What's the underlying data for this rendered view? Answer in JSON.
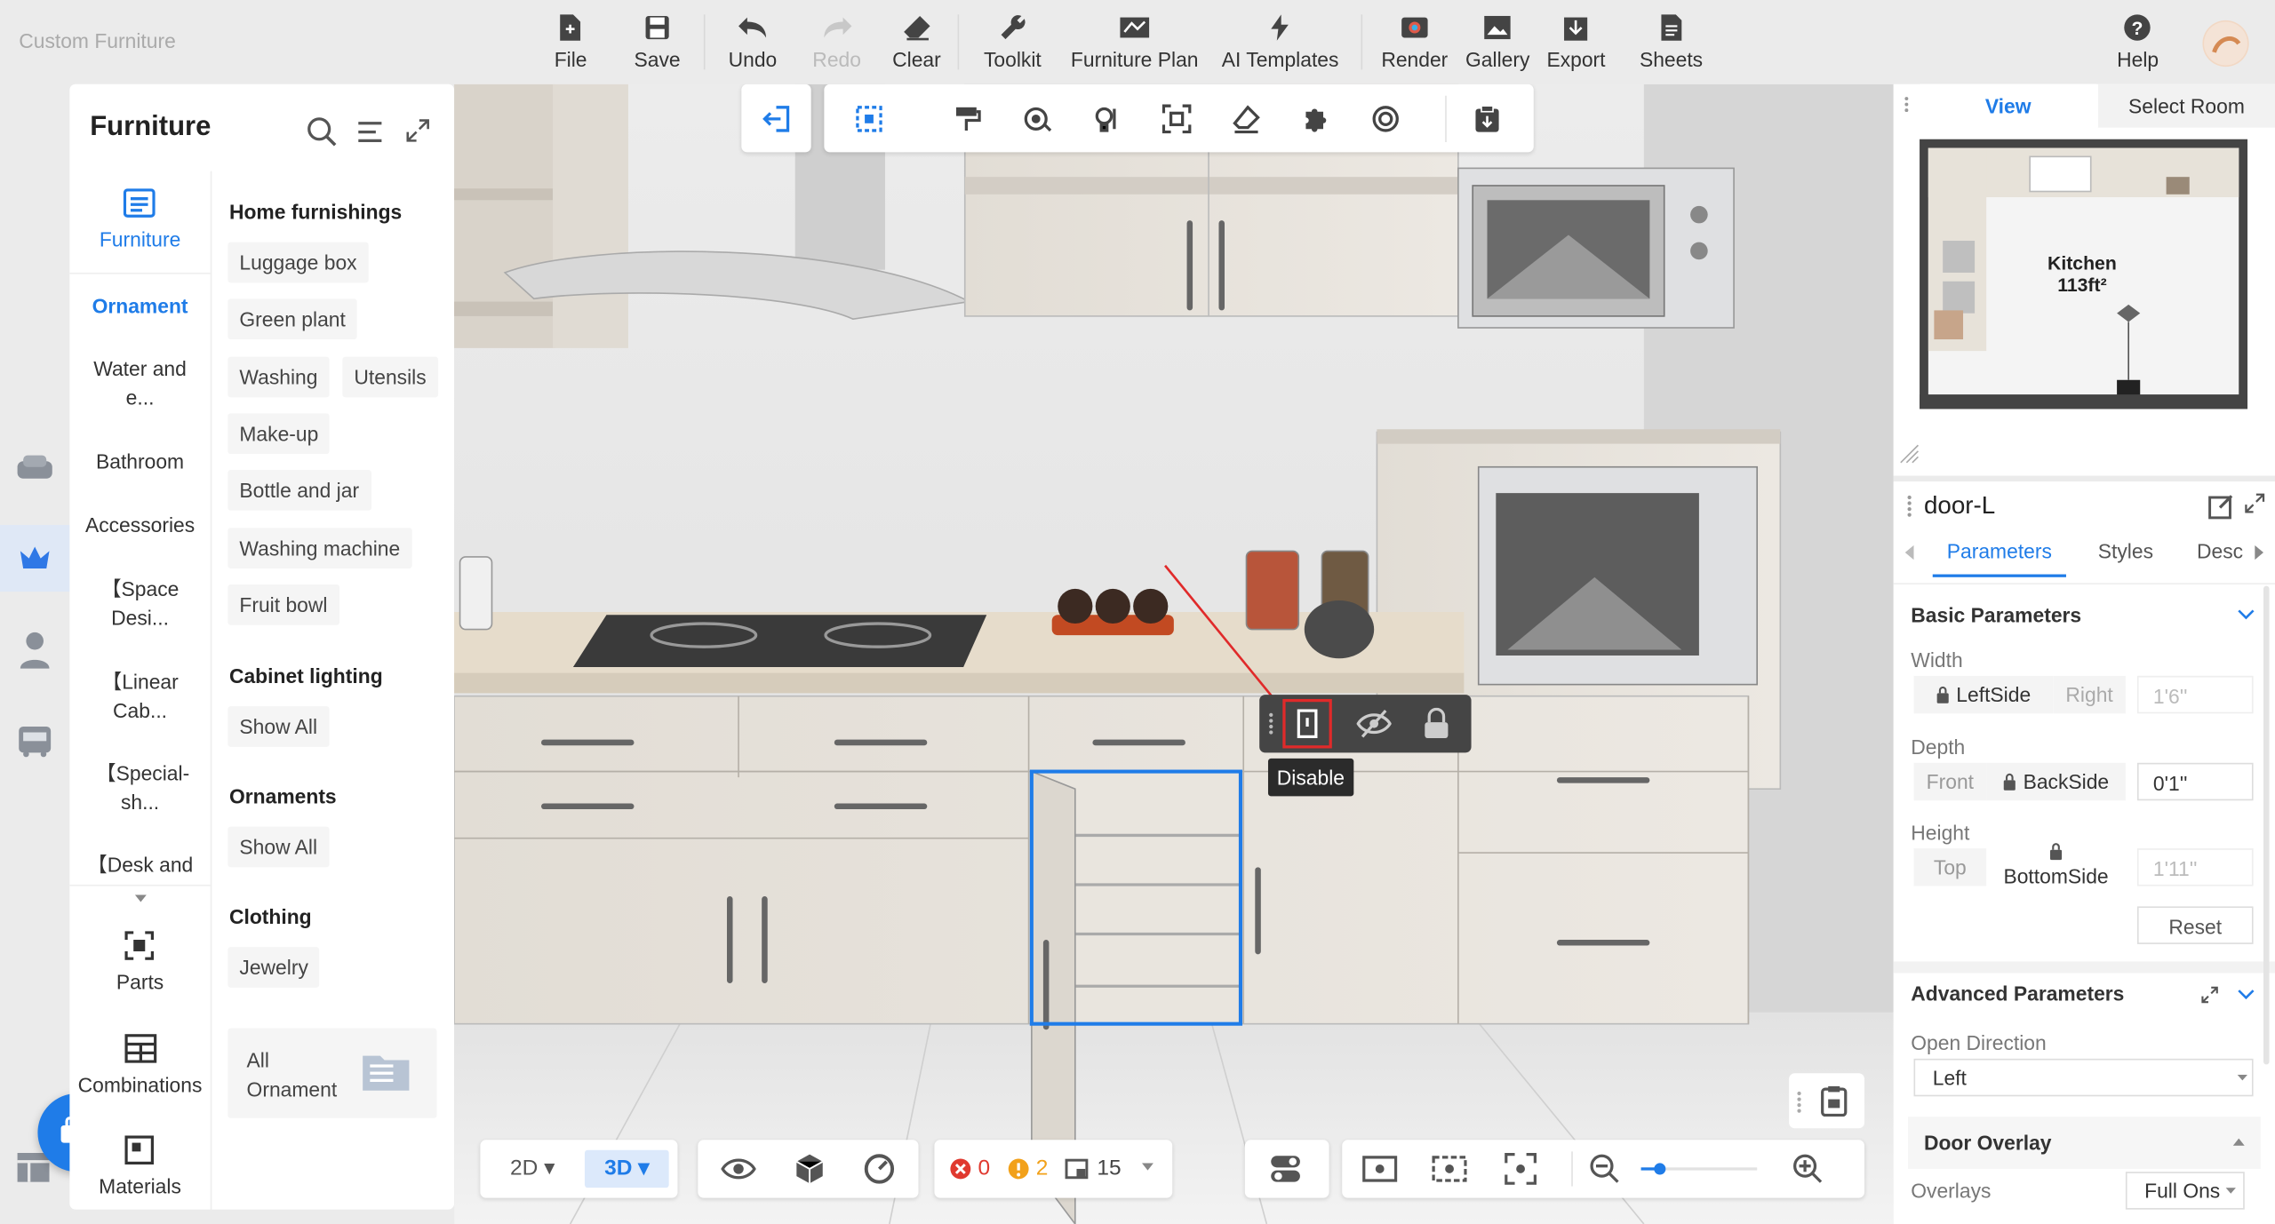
{
  "app_title": "Custom Furniture",
  "toolbar": {
    "file": "File",
    "save": "Save",
    "undo": "Undo",
    "redo": "Redo",
    "clear": "Clear",
    "toolkit": "Toolkit",
    "furniture_plan": "Furniture Plan",
    "ai_templates": "AI Templates",
    "render": "Render",
    "gallery": "Gallery",
    "export": "Export",
    "sheets": "Sheets",
    "help": "Help"
  },
  "left_panel": {
    "title": "Furniture",
    "categories": {
      "furniture": "Furniture",
      "ornament": "Ornament",
      "water": "Water and e...",
      "bathroom": "Bathroom",
      "accessories": "Accessories",
      "space": "【Space Desi...",
      "linear": "【Linear Cab...",
      "special": "【Special-sh...",
      "desk": "【Desk and",
      "parts": "Parts",
      "combinations": "Combinations",
      "materials": "Materials"
    },
    "sections": {
      "home": "Home furnishings",
      "cabinet": "Cabinet lighting",
      "ornaments": "Ornaments",
      "clothing": "Clothing"
    },
    "tags": {
      "luggage": "Luggage box",
      "green": "Green plant",
      "washing": "Washing",
      "utensils": "Utensils",
      "makeup": "Make-up",
      "bottle": "Bottle and jar",
      "machine": "Washing machine",
      "fruit": "Fruit bowl",
      "show_all_1": "Show All",
      "show_all_2": "Show All",
      "jewelry": "Jewelry"
    },
    "all_ornament": "All Ornament"
  },
  "context_toolbar": {
    "tooltip": "Disable"
  },
  "view_panel": {
    "tab_view": "View",
    "tab_select_room": "Select Room",
    "room_name": "Kitchen",
    "room_area": "113ft²"
  },
  "prop_panel": {
    "title": "door-L",
    "tabs": {
      "parameters": "Parameters",
      "styles": "Styles",
      "desc": "Desc"
    },
    "basic": "Basic Parameters",
    "width": {
      "label": "Width",
      "left": "LeftSide",
      "right": "Right",
      "value": "1'6''"
    },
    "depth": {
      "label": "Depth",
      "front": "Front",
      "back": "BackSide",
      "value": "0'1''"
    },
    "height": {
      "label": "Height",
      "top": "Top",
      "bottom": "BottomSide",
      "value": "1'11''"
    },
    "reset": "Reset",
    "advanced": "Advanced Parameters",
    "open_direction": {
      "label": "Open Direction",
      "value": "Left"
    },
    "door_overlay": "Door Overlay",
    "overlays": {
      "label": "Overlays",
      "value": "Full Ons"
    }
  },
  "bottom_bar": {
    "mode_2d": "2D",
    "mode_3d": "3D",
    "errors": "0",
    "warnings": "2",
    "objects": "15"
  }
}
